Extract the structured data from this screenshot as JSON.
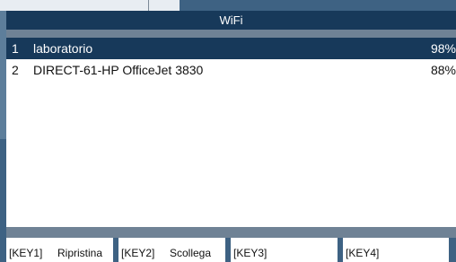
{
  "dialog": {
    "title": "WiFi"
  },
  "networks": [
    {
      "index": "1",
      "ssid": "laboratorio",
      "signal": "98%",
      "selected": true
    },
    {
      "index": "2",
      "ssid": "DIRECT-61-HP OfficeJet 3830",
      "signal": "88%",
      "selected": false
    }
  ],
  "softkeys": [
    {
      "key": "[KEY1]",
      "label": "Ripristina"
    },
    {
      "key": "[KEY2]",
      "label": "Scollega"
    },
    {
      "key": "[KEY3]",
      "label": ""
    },
    {
      "key": "[KEY4]",
      "label": ""
    }
  ],
  "colors": {
    "title_bar": "#17395a",
    "selection": "#17395a",
    "strip": "#6f8295",
    "desktop": "#3e6283"
  }
}
